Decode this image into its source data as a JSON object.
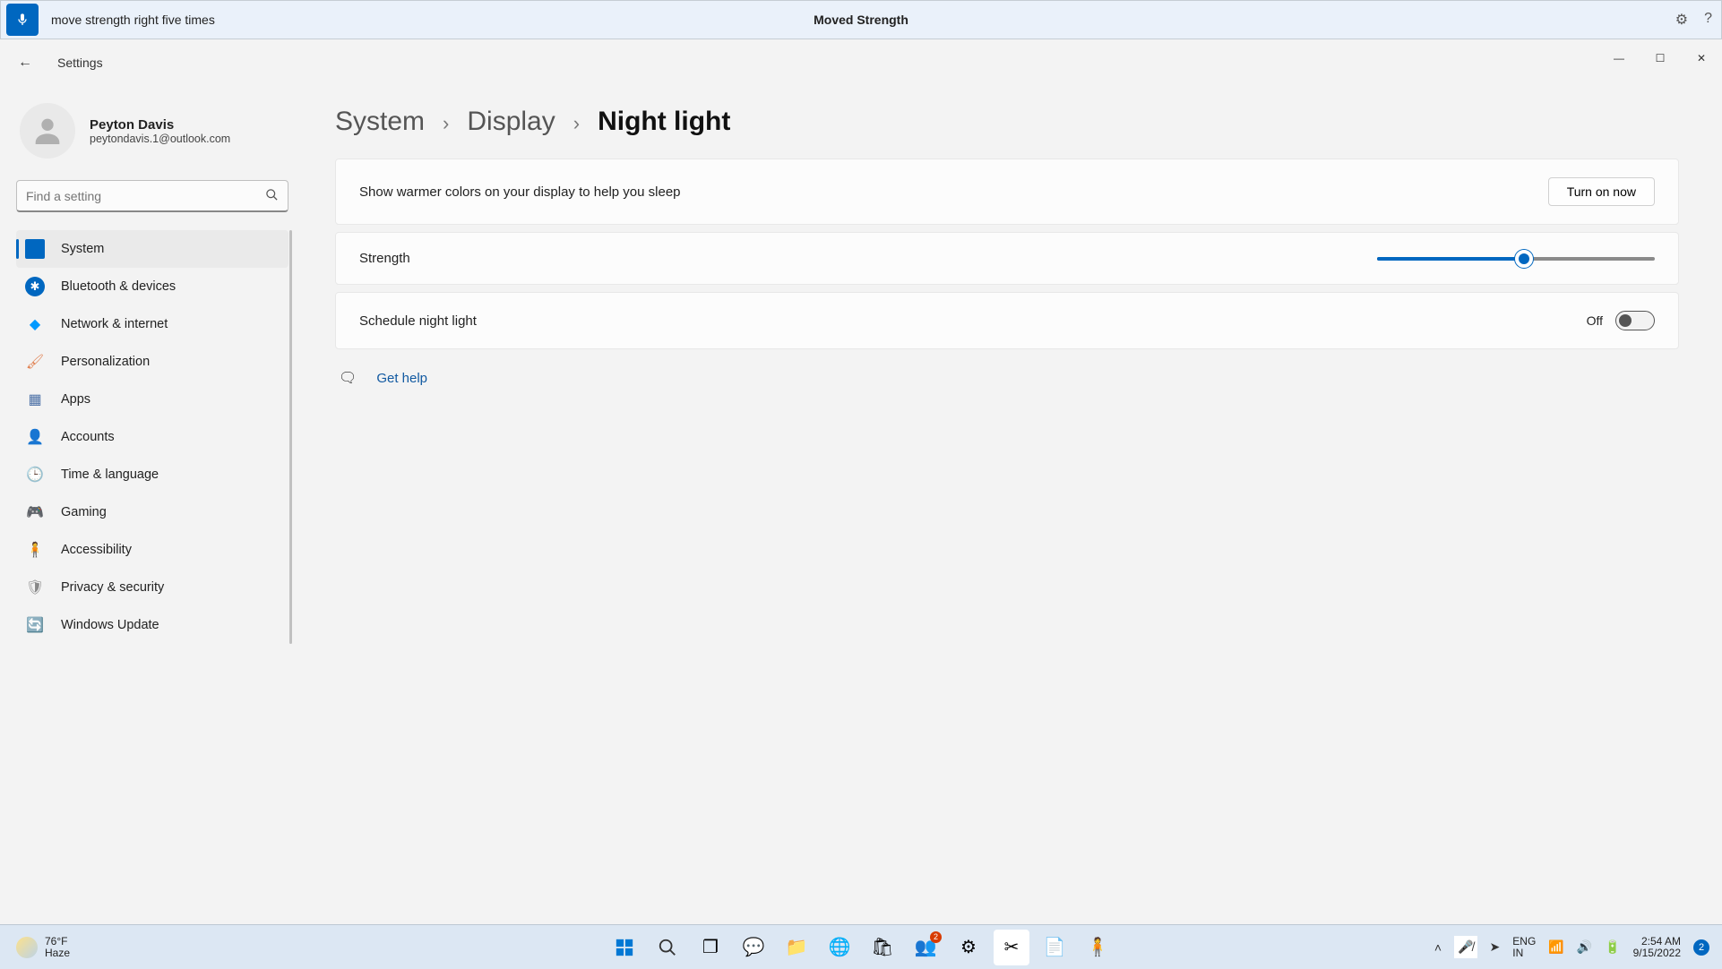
{
  "voicebar": {
    "command": "move strength right five times",
    "title": "Moved Strength"
  },
  "window": {
    "title": "Settings"
  },
  "user": {
    "name": "Peyton Davis",
    "email": "peytondavis.1@outlook.com"
  },
  "search": {
    "placeholder": "Find a setting"
  },
  "nav": {
    "items": [
      {
        "label": "System",
        "active": true,
        "color": "#0067c0"
      },
      {
        "label": "Bluetooth & devices",
        "color": "#0067c0"
      },
      {
        "label": "Network & internet",
        "color": "#0099ff"
      },
      {
        "label": "Personalization",
        "color": "#e08050"
      },
      {
        "label": "Apps",
        "color": "#4a6fa5"
      },
      {
        "label": "Accounts",
        "color": "#2fb380"
      },
      {
        "label": "Time & language",
        "color": "#5aa0d8"
      },
      {
        "label": "Gaming",
        "color": "#888"
      },
      {
        "label": "Accessibility",
        "color": "#0067c0"
      },
      {
        "label": "Privacy & security",
        "color": "#888"
      },
      {
        "label": "Windows Update",
        "color": "#0099ee"
      }
    ]
  },
  "breadcrumb": {
    "p1": "System",
    "p2": "Display",
    "current": "Night light"
  },
  "cards": {
    "warmer": {
      "label": "Show warmer colors on your display to help you sleep",
      "button": "Turn on now"
    },
    "strength": {
      "label": "Strength",
      "value_pct": 53
    },
    "schedule": {
      "label": "Schedule night light",
      "state": "Off"
    }
  },
  "gethelp": {
    "label": "Get help"
  },
  "taskbar": {
    "weather_temp": "76°F",
    "weather_cond": "Haze",
    "lang1": "ENG",
    "lang2": "IN",
    "time": "2:54 AM",
    "date": "9/15/2022",
    "notif_count": "2"
  }
}
